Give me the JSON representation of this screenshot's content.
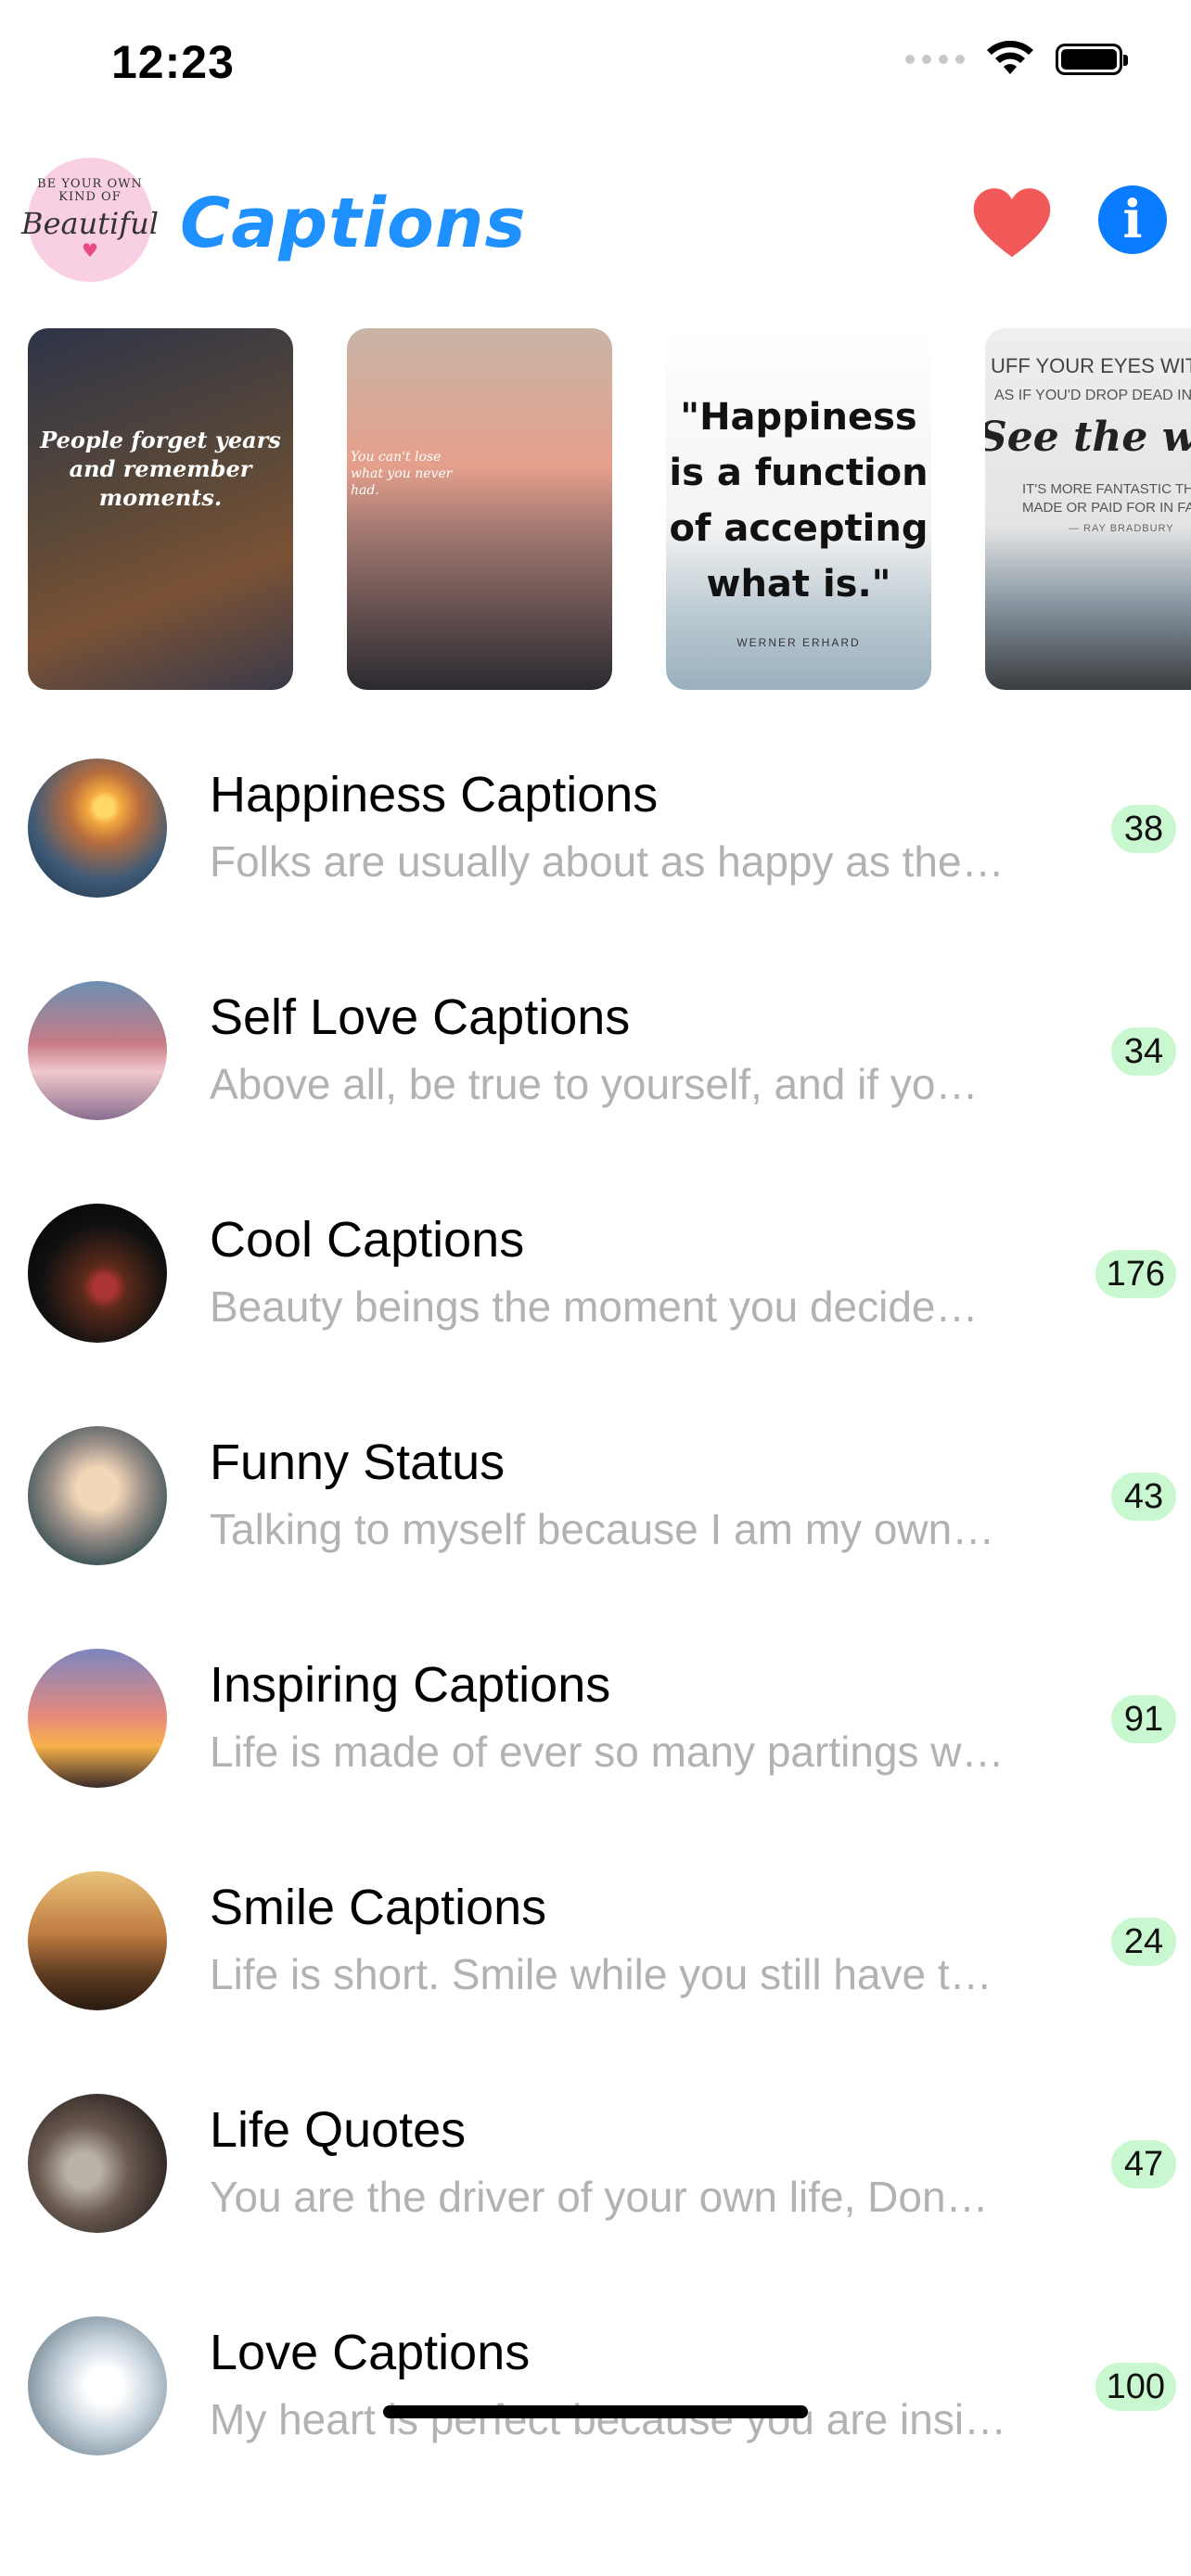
{
  "status_bar": {
    "time": "12:23"
  },
  "header": {
    "title": "Captions",
    "logo_text": {
      "line1": "BE YOUR OWN",
      "line2": "KIND OF",
      "word": "Beautiful"
    }
  },
  "carousel": [
    {
      "text": "People forget years and remember moments."
    },
    {
      "text": "You can't lose what you never had."
    },
    {
      "text": "\"Happiness is a function of accepting what is.\"",
      "author": "WERNER ERHARD"
    },
    {
      "line1": "UFF YOUR EYES WITH",
      "line2": "AS IF YOU'D DROP DEAD IN",
      "big": "See the wor",
      "line3": "IT'S MORE FANTASTIC THAN ANY",
      "line4": "MADE OR PAID FOR IN FACT",
      "author": "— RAY BRADBURY"
    }
  ],
  "categories": [
    {
      "title": "Happiness Captions",
      "subtitle": "Folks are usually about as happy as the…",
      "count": "38"
    },
    {
      "title": "Self Love Captions",
      "subtitle": "Above all, be true to yourself, and if yo…",
      "count": "34"
    },
    {
      "title": "Cool Captions",
      "subtitle": "Beauty beings the moment you decide…",
      "count": "176"
    },
    {
      "title": "Funny Status",
      "subtitle": "Talking to myself because I am my own…",
      "count": "43"
    },
    {
      "title": "Inspiring Captions",
      "subtitle": "Life is made of ever so many partings w…",
      "count": "91"
    },
    {
      "title": "Smile Captions",
      "subtitle": "Life is short. Smile while you still have t…",
      "count": "24"
    },
    {
      "title": "Life Quotes",
      "subtitle": "You are the driver of your own life, Don…",
      "count": "47"
    },
    {
      "title": "Love Captions",
      "subtitle": "My heart is perfect because you are insi…",
      "count": "100"
    }
  ],
  "colors": {
    "title_blue": "#1e90ff",
    "heart_red": "#f25a5a",
    "info_blue": "#0a7cff",
    "badge_green": "#c9f7cf",
    "subtitle_gray": "#b2b2b2"
  },
  "icons": {
    "favorites": "heart-icon",
    "info": "info-icon",
    "wifi": "wifi-icon",
    "battery": "battery-icon",
    "signal": "signal-icon"
  }
}
